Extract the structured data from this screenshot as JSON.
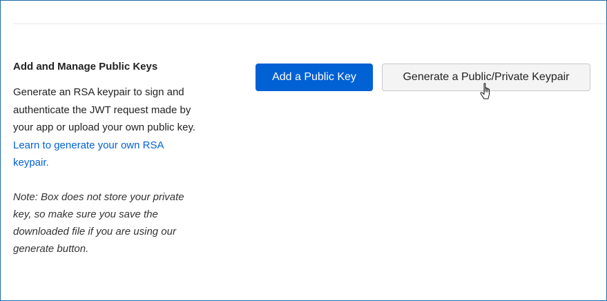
{
  "section": {
    "title": "Add and Manage Public Keys",
    "desc_line_1": "Generate an RSA keypair to sign and",
    "desc_line_2": "authenticate the JWT request made by",
    "desc_line_3": "your app or upload your own public key.",
    "link_line_1": "Learn to generate your own RSA",
    "link_line_2": "keypair.",
    "note_line_1": "Note: Box does not store your private",
    "note_line_2": "key, so make sure you save the",
    "note_line_3": "downloaded file if you are using our",
    "note_line_4": "generate button."
  },
  "buttons": {
    "add_public_key": "Add a Public Key",
    "generate_keypair": "Generate a Public/Private Keypair"
  },
  "colors": {
    "primary": "#0061d5",
    "link": "#0061d5",
    "frame_border": "#1b6aa5"
  },
  "icons": {
    "cursor": "hand-pointer-icon"
  }
}
